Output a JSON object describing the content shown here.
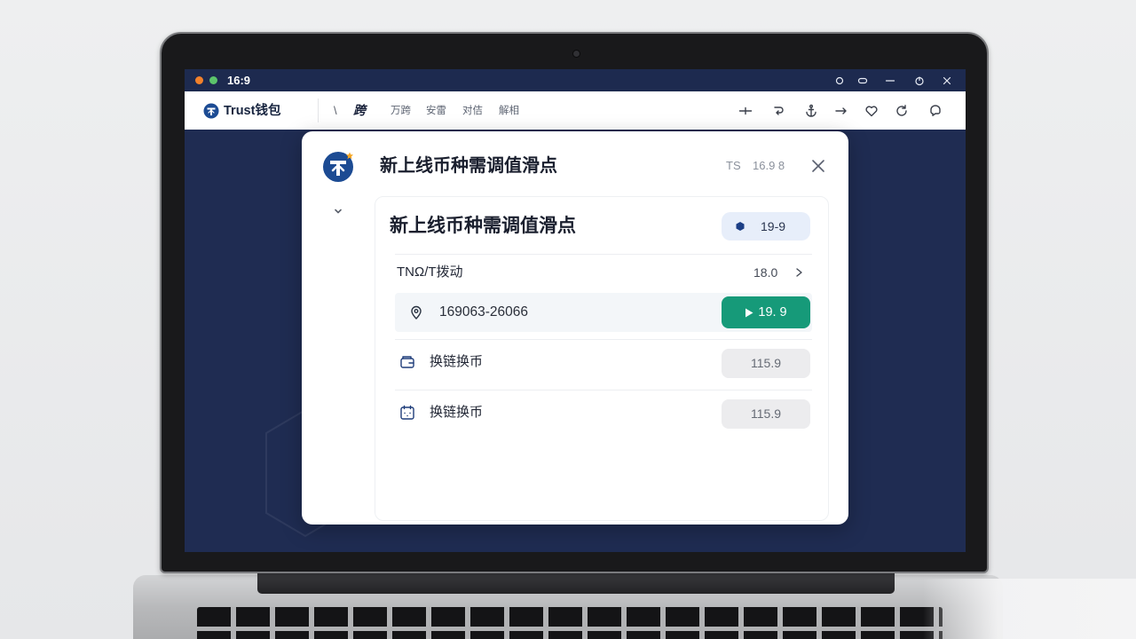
{
  "colors": {
    "screen_bg": "#1f2c52",
    "brand_blue": "#1c4b93",
    "action_green": "#169a79",
    "window_dot_orange": "#f2812b",
    "window_dot_green": "#5cc46b"
  },
  "window": {
    "title": "16:9",
    "controls": [
      "circle-icon",
      "pill-icon",
      "minimize-icon",
      "settings-icon",
      "close-icon"
    ]
  },
  "nav": {
    "brand": "Trust钱包",
    "logo_icon": "trust-logo",
    "separator": "\\",
    "tabs": [
      {
        "label": "跨",
        "active": true
      },
      {
        "label": "万跨"
      },
      {
        "label": "安雷"
      },
      {
        "label": "对佶"
      },
      {
        "label": "解相"
      }
    ],
    "actions": [
      "plus-icon",
      "curl-arrow-icon",
      "anchor-icon",
      "arrow-right-icon",
      "heart-icon",
      "refresh-icon",
      "chat-icon"
    ]
  },
  "modal": {
    "title": "新上线币种需调值滑点",
    "meta_label": "TS",
    "meta_value": "16.9 8",
    "card": {
      "heading": "新上线币种需调值滑点",
      "badge": "19-9",
      "pair": {
        "label": "TNΩ/T拨动",
        "value": "18.0"
      },
      "route": {
        "icon": "location-pin-icon",
        "text": "169063-26066",
        "button": "19. 9"
      },
      "rows": [
        {
          "icon": "wallet-icon",
          "label": "换链换币",
          "value": "115.9"
        },
        {
          "icon": "calendar-icon",
          "label": "换链换币",
          "value": "115.9"
        }
      ]
    }
  }
}
